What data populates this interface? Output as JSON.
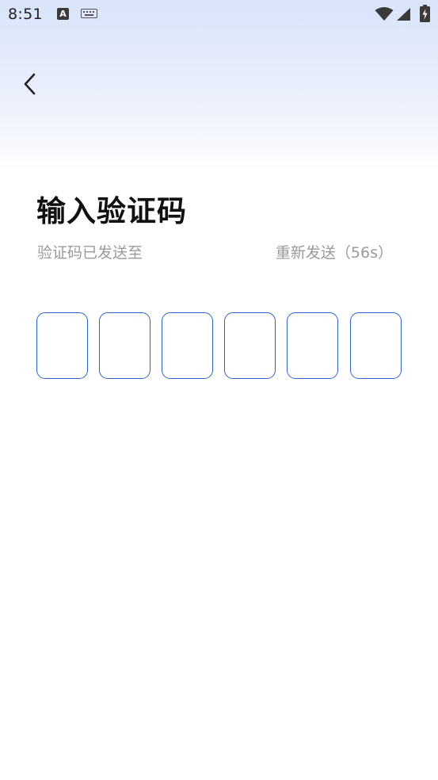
{
  "status_bar": {
    "time": "8:51",
    "notification_icon_letter": "A",
    "icons": [
      "app-notification-icon",
      "keyboard-icon",
      "wifi-icon",
      "signal-icon",
      "battery-charging-icon"
    ]
  },
  "header": {
    "back_icon": "chevron-left-icon"
  },
  "main": {
    "title": "输入验证码",
    "sent_to_label": "验证码已发送至",
    "resend_label": "重新发送（56s）",
    "code_boxes": [
      "",
      "",
      "",
      "",
      "",
      ""
    ]
  },
  "colors": {
    "accent": "#2a63d8",
    "title_text": "#111111",
    "secondary_text": "#9a9a9a",
    "gradient_top": "#d9e4fa"
  }
}
